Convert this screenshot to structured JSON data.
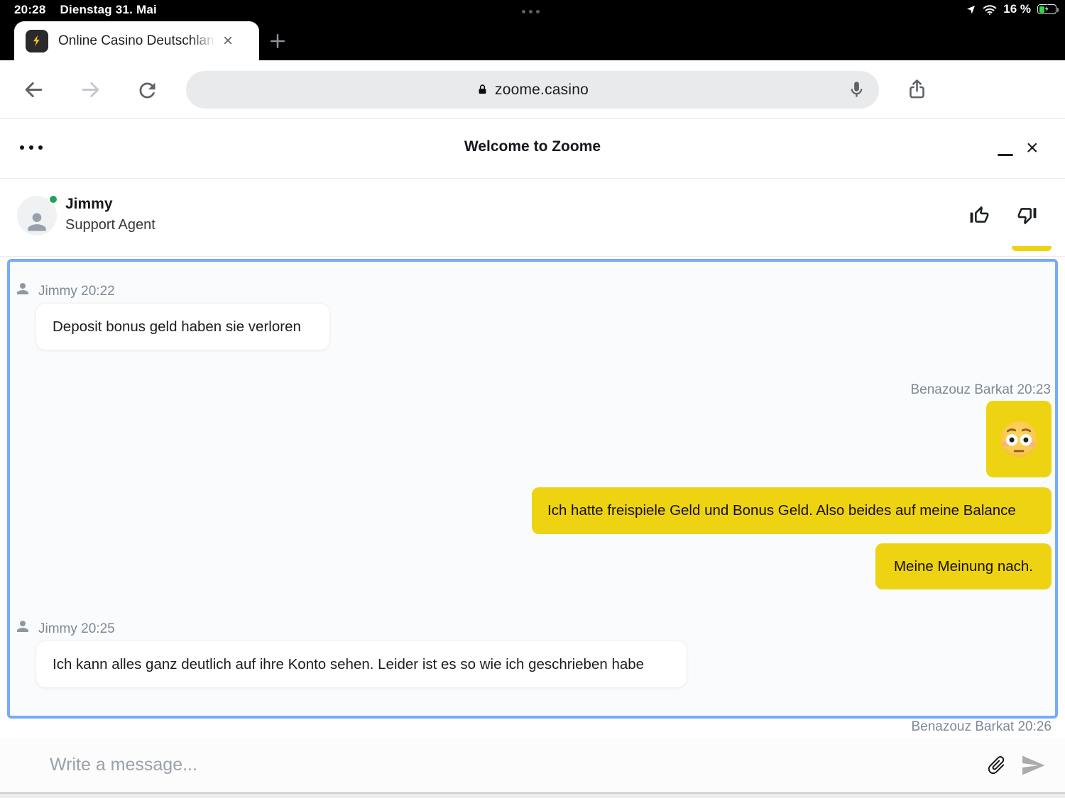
{
  "status_bar": {
    "time": "20:28",
    "date": "Dienstag 31. Mai",
    "battery_percent": "16 %"
  },
  "browser": {
    "tab_title": "Online Casino Deutschlan",
    "tab_close": "×",
    "url": "zoome.casino",
    "tab_count": "1"
  },
  "chat": {
    "title": "Welcome to Zoome",
    "agent": {
      "name": "Jimmy",
      "role": "Support Agent",
      "status": "online"
    },
    "messages": [
      {
        "label": "Jimmy 20:22",
        "text": "Deposit bonus geld haben sie verloren",
        "side": "left"
      },
      {
        "label": "Benazouz Barkat 20:23",
        "emoji": "flushed-face",
        "side": "right"
      },
      {
        "text": "Ich hatte freispiele Geld und Bonus Geld. Also beides auf meine Balance",
        "side": "right"
      },
      {
        "text": "Meine Meinung nach.",
        "side": "right"
      },
      {
        "label": "Jimmy 20:25",
        "text": "Ich kann alles ganz deutlich auf ihre Konto sehen. Leider ist es so wie ich geschrieben habe",
        "side": "left"
      },
      {
        "label": "Benazouz Barkat 20:26",
        "side": "right",
        "clipped": true
      }
    ],
    "composer": {
      "placeholder": "Write a message..."
    }
  },
  "colors": {
    "accent_yellow": "#eed312",
    "focus_blue": "#78abf7",
    "online_green": "#1fa35c",
    "battery_green": "#32d74b"
  }
}
